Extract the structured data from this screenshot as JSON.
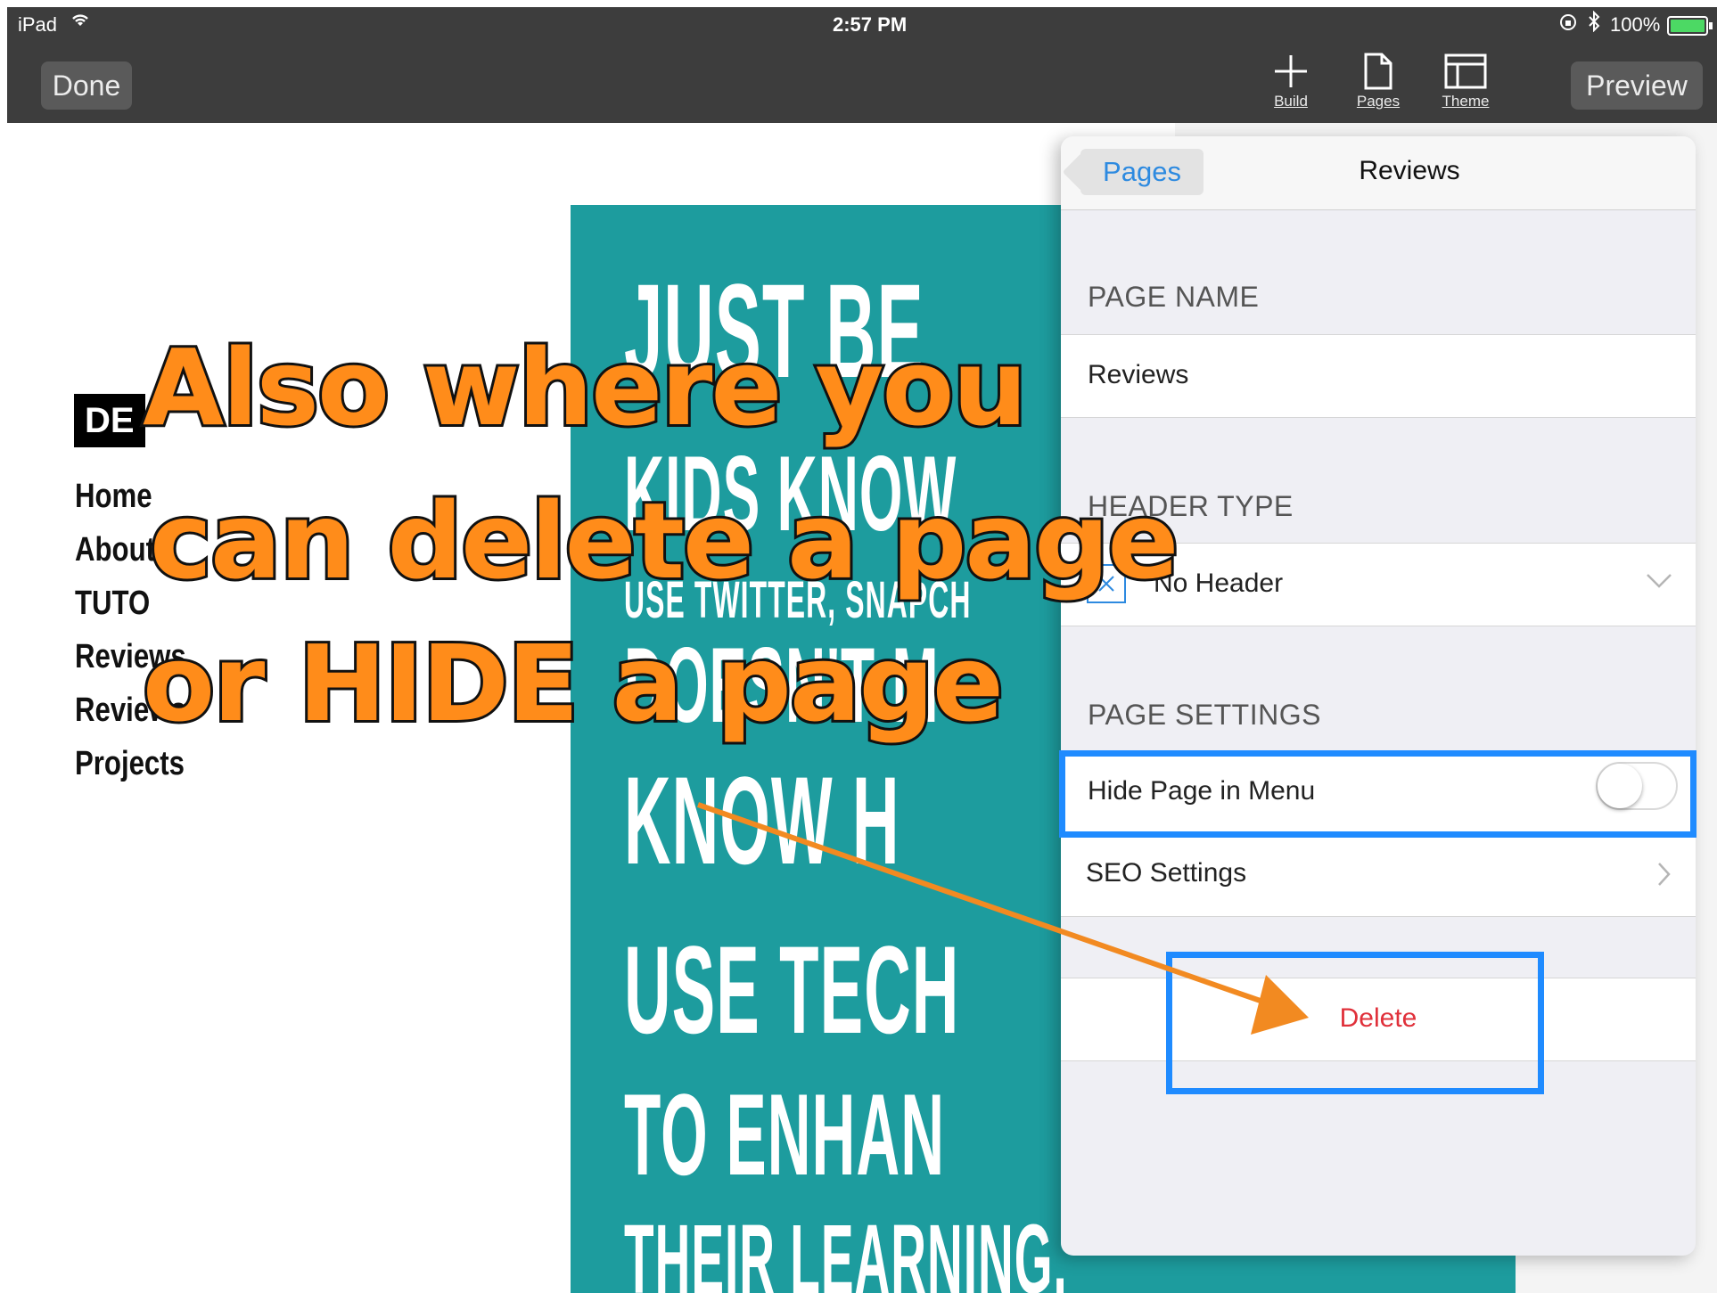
{
  "status_bar": {
    "device": "iPad",
    "time": "2:57 PM",
    "battery": "100%"
  },
  "toolbar": {
    "done_label": "Done",
    "preview_label": "Preview",
    "build_label": "Build",
    "pages_label": "Pages",
    "theme_label": "Theme"
  },
  "site": {
    "title_fragment": "DE",
    "nav": [
      "Home",
      "About",
      "TUTO",
      "Reviews",
      "Reviews",
      "Projects"
    ]
  },
  "poster": {
    "lines": [
      "JUST BE",
      "KIDS KNOW",
      "USE TWITTER, SNAPCH",
      "DOESN'T M",
      "KNOW H",
      "USE TECH",
      "TO ENHAN",
      "THEIR LEARNING."
    ]
  },
  "panel": {
    "back_label": "Pages",
    "title": "Reviews",
    "page_name_header": "PAGE NAME",
    "page_name_value": "Reviews",
    "header_type_header": "HEADER TYPE",
    "header_type_value": "No Header",
    "page_settings_header": "PAGE SETTINGS",
    "hide_page_label": "Hide Page in Menu",
    "hide_page_enabled": false,
    "seo_label": "SEO Settings",
    "delete_label": "Delete"
  },
  "annotation": {
    "line1": "Also where you",
    "line2": "can delete a page",
    "line3": "or HIDE a page"
  },
  "colors": {
    "accent_blue": "#1f8bff",
    "annotation_orange": "#ff8c1a",
    "delete_red": "#e0303a",
    "poster_teal": "#1d9c9e"
  }
}
